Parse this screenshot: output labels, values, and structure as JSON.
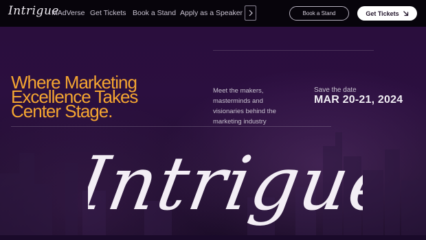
{
  "nav": {
    "logo": "Intrigue",
    "links": [
      "MAdVerse",
      "Get Tickets",
      "Book a Stand",
      "Apply as a Speaker"
    ],
    "more_icon": "chevron-right-icon",
    "book_stand_button": "Book a Stand",
    "get_tickets_button": "Get Tickets",
    "get_tickets_icon": "arrow-down-right-icon"
  },
  "hero": {
    "headline_lines": [
      "Where Marketing",
      "Excellence Takes",
      "Center Stage."
    ],
    "intro_lines": [
      "Meet the makers,",
      "masterminds and",
      "visionaries behind the",
      "marketing industry"
    ],
    "save_label": "Save the date",
    "date": "MAR 20-21, 2024",
    "script_title": "Intrigue"
  },
  "colors": {
    "accent": "#f4a531",
    "nav_bg": "#07040b",
    "hero_bg": "#2b0f3f",
    "text_light": "#f1eef4"
  }
}
